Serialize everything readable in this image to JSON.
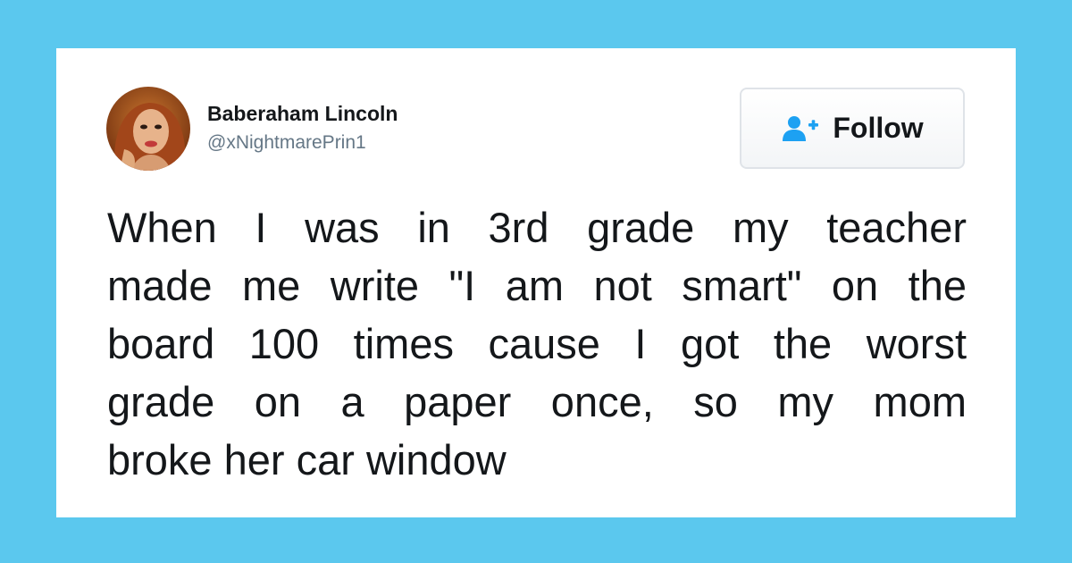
{
  "background_color": "#5bc8ee",
  "tweet": {
    "author": {
      "display_name": "Baberaham Lincoln",
      "handle": "@xNightmarePrin1",
      "avatar_icon": "profile-photo"
    },
    "follow_button": {
      "icon": "add-user-icon",
      "label": "Follow",
      "icon_color": "#1da1f2"
    },
    "text_lines": [
      "When I was in 3rd grade my teacher",
      "made me write \"I am not smart\" on the",
      "board 100 times cause I got the worst",
      "grade on a paper once, so my mom",
      "broke her car window"
    ]
  }
}
